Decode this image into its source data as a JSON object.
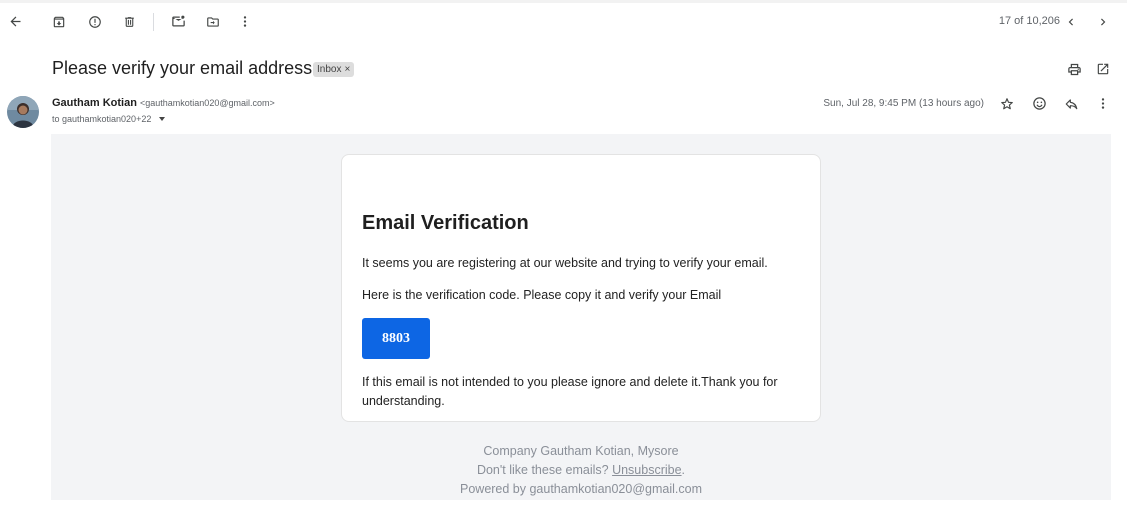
{
  "toolbar": {
    "icons": [
      "back-arrow-icon",
      "archive-icon",
      "report-spam-icon",
      "delete-icon",
      "mark-unread-icon",
      "move-to-icon",
      "more-vert-icon"
    ],
    "pager_text": "17 of 10,206"
  },
  "subject": {
    "title": "Please verify your email address",
    "label": "Inbox",
    "label_remove": "×"
  },
  "message": {
    "sender_name": "Gautham Kotian",
    "sender_email": "<gauthamkotian020@gmail.com>",
    "to": "to gauthamkotian020+22",
    "date": "Sun, Jul 28, 9:45 PM (13 hours ago)"
  },
  "email": {
    "heading": "Email Verification",
    "p1": "It seems you are registering at our website and trying to verify your email.",
    "p2": "Here is the verification code. Please copy it and verify your Email",
    "code": "8803",
    "p3": "If this email is not intended to you please ignore and delete it.Thank you for understanding.",
    "button_color": "#0d66e4"
  },
  "footer": {
    "company": "Company Gautham Kotian, Mysore",
    "dont_like": "Don't like these emails?",
    "unsubscribe": "Unsubscribe",
    "period": ".",
    "powered": "Powered by gauthamkotian020@gmail.com"
  }
}
